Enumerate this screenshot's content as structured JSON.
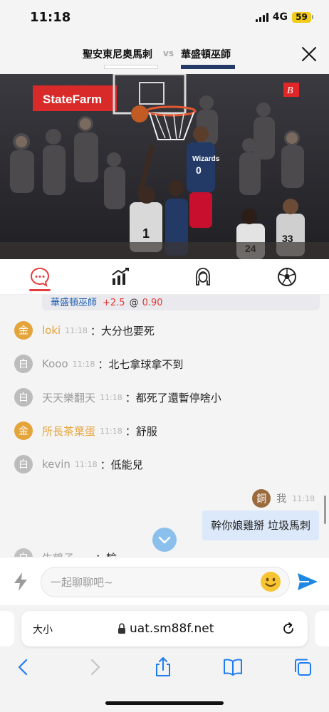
{
  "status_bar": {
    "time": "11:18",
    "network": "4G",
    "battery": "59"
  },
  "match": {
    "home_team": "聖安東尼奧馬刺",
    "vs": "vs",
    "away_team": "華盛頓巫師"
  },
  "tabs": [
    {
      "icon": "chat-icon",
      "active": true
    },
    {
      "icon": "stats-chart-icon",
      "active": false
    },
    {
      "icon": "girl-avatar-icon",
      "active": false
    },
    {
      "icon": "soccer-ball-icon",
      "active": false
    }
  ],
  "bet": {
    "team": "華盛頓巫師",
    "line": "+2.5",
    "at": "@",
    "odds": "0.90"
  },
  "messages": [
    {
      "badge": "金",
      "name": "loki",
      "time": "11:18",
      "text": "：大分也要死"
    },
    {
      "badge": "白",
      "name": "Kooo",
      "time": "11:18",
      "text": "：北七拿球拿不到"
    },
    {
      "badge": "白",
      "name": "天天樂翻天",
      "time": "11:18",
      "text": "：都死了還暫停啥小"
    },
    {
      "badge": "金",
      "name": "所長茶葉蛋",
      "time": "11:18",
      "text": "：舒服"
    },
    {
      "badge": "白",
      "name": "kevin",
      "time": "11:18",
      "text": "：低能兒"
    }
  ],
  "self_message": {
    "badge": "銅",
    "name": "我",
    "time": "11:18",
    "text": "幹你娘雞掰 垃圾馬刺"
  },
  "peek_message": {
    "badge": "白",
    "name": "牛鶴子",
    "text": "：輸"
  },
  "composer": {
    "placeholder": "一起聊聊吧~"
  },
  "browser": {
    "text_size": "大小",
    "url": "uat.sm88f.net"
  },
  "colors": {
    "accent_red": "#e53c3c",
    "gold": "#e4a43b",
    "send_blue": "#1e88e5",
    "self_bubble": "#dce9fa"
  }
}
